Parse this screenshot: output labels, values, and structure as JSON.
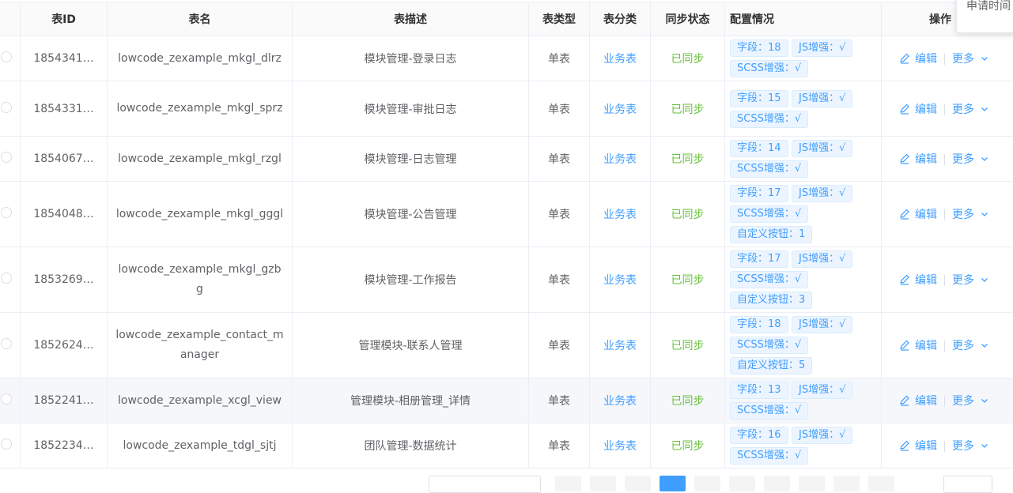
{
  "columns": {
    "id": "表ID",
    "name": "表名",
    "desc": "表描述",
    "type": "表类型",
    "category": "表分类",
    "sync": "同步状态",
    "config": "配置情况",
    "ops": "操作"
  },
  "popper_text": "申请时间",
  "rows": [
    {
      "id": "1854341…",
      "name": "lowcode_zexample_mkgl_dlrz",
      "desc": "模块管理-登录日志",
      "type": "单表",
      "category": "业务表",
      "sync": "已同步",
      "tags": [
        "字段：18",
        "JS增强：√",
        "SCSS增强：√"
      ]
    },
    {
      "id": "1854331…",
      "name": "lowcode_zexample_mkgl_sprz",
      "desc": "模块管理-审批日志",
      "type": "单表",
      "category": "业务表",
      "sync": "已同步",
      "tags": [
        "字段：15",
        "JS增强：√",
        "SCSS增强：√"
      ]
    },
    {
      "id": "1854067…",
      "name": "lowcode_zexample_mkgl_rzgl",
      "desc": "模块管理-日志管理",
      "type": "单表",
      "category": "业务表",
      "sync": "已同步",
      "tags": [
        "字段：14",
        "JS增强：√",
        "SCSS增强：√"
      ]
    },
    {
      "id": "1854048…",
      "name": "lowcode_zexample_mkgl_gggl",
      "desc": "模块管理-公告管理",
      "type": "单表",
      "category": "业务表",
      "sync": "已同步",
      "tags": [
        "字段：17",
        "JS增强：√",
        "SCSS增强：√",
        "自定义按钮：1"
      ]
    },
    {
      "id": "1853269…",
      "name": "lowcode_zexample_mkgl_gzbg",
      "desc": "模块管理-工作报告",
      "type": "单表",
      "category": "业务表",
      "sync": "已同步",
      "tags": [
        "字段：17",
        "JS增强：√",
        "SCSS增强：√",
        "自定义按钮：3"
      ]
    },
    {
      "id": "1852624…",
      "name": "lowcode_zexample_contact_manager",
      "desc": "管理模块-联系人管理",
      "type": "单表",
      "category": "业务表",
      "sync": "已同步",
      "tags": [
        "字段：18",
        "JS增强：√",
        "SCSS增强：√",
        "自定义按钮：5"
      ]
    },
    {
      "id": "1852241…",
      "name": "lowcode_zexample_xcgl_view",
      "desc": "管理模块-相册管理_详情",
      "type": "单表",
      "category": "业务表",
      "sync": "已同步",
      "tags": [
        "字段：13",
        "JS增强：√",
        "SCSS增强：√"
      ]
    },
    {
      "id": "1852234…",
      "name": "lowcode_zexample_tdgl_sjtj",
      "desc": "团队管理-数据统计",
      "type": "单表",
      "category": "业务表",
      "sync": "已同步",
      "tags": [
        "字段：16",
        "JS增强：√",
        "SCSS增强：√"
      ]
    }
  ],
  "actions": {
    "edit": "编辑",
    "more": "更多"
  },
  "colors": {
    "primary": "#409eff",
    "success": "#67c23a",
    "header_bg": "#fafafa",
    "border": "#ebeef5"
  }
}
